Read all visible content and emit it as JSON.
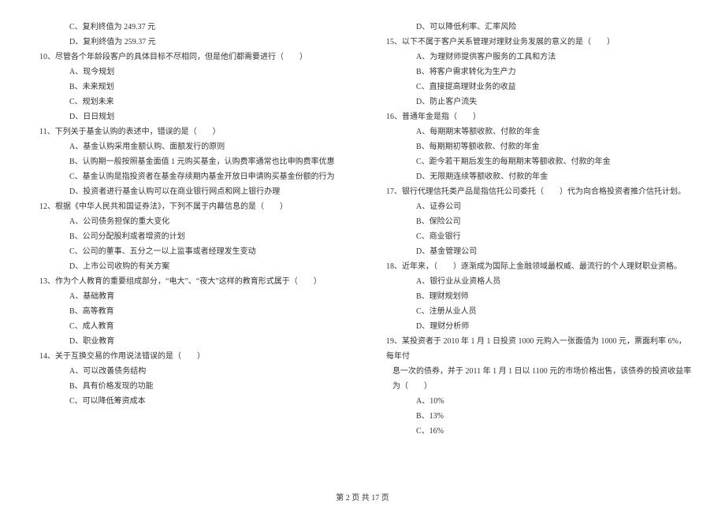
{
  "left": {
    "pre_opts": [
      "C、复利终值为 249.37 元",
      "D、复利终值为 259.37 元"
    ],
    "q10": {
      "stem": "10、尽管各个年龄段客户的具体目标不尽相同，但是他们都需要进行（　　）",
      "opts": [
        "A、现今规划",
        "B、未来规划",
        "C、规划未来",
        "D、日日规划"
      ]
    },
    "q11": {
      "stem": "11、下列关于基金认购的表述中，错误的是（　　）",
      "opts": [
        "A、基金认购采用金额认购、面额发行的原则",
        "B、认购期一般按照基金面值 1 元购买基金，认购费率通常也比申购费率优惠",
        "C、基金认购是指投资者在基金存续期内基金开放日申请购买基金份额的行为",
        "D、投资者进行基金认购可以在商业银行网点和网上银行办理"
      ]
    },
    "q12": {
      "stem": "12、根据《中华人民共和国证券法》，下列不属于内幕信息的是（　　）",
      "opts": [
        "A、公司债务担保的重大变化",
        "B、公司分配股利或者增资的计划",
        "C、公司的董事、五分之一以上监事或者经理发生变动",
        "D、上市公司收购的有关方案"
      ]
    },
    "q13": {
      "stem": "13、作为个人教育的重要组成部分，“电大”、“夜大”这样的教育形式属于（　　）",
      "opts": [
        "A、基础教育",
        "B、高等教育",
        "C、成人教育",
        "D、职业教育"
      ]
    },
    "q14": {
      "stem": "14、关于互换交易的作用说法错误的是（　　）",
      "opts": [
        "A、可以改善债务结构",
        "B、具有价格发现的功能",
        "C、可以降低筹资成本"
      ]
    }
  },
  "right": {
    "pre_opts": [
      "D、可以降低利率、汇率风险"
    ],
    "q15": {
      "stem": "15、以下不属于客户关系管理对理财业务发展的意义的是（　　）",
      "opts": [
        "A、为理财师提供客户服务的工具和方法",
        "B、将客户需求转化为生产力",
        "C、直接提高理财业务的收益",
        "D、防止客户流失"
      ]
    },
    "q16": {
      "stem": "16、普通年金是指（　　）",
      "opts": [
        "A、每期期末等额收款、付款的年金",
        "B、每期期初等额收款、付款的年金",
        "C、距今若干期后发生的每期期末等额收款、付款的年金",
        "D、无限期连续等额收款、付款的年金"
      ]
    },
    "q17": {
      "stem": "17、银行代理信托类产品是指信托公司委托（　　）代为向合格投资者推介信托计划。",
      "opts": [
        "A、证券公司",
        "B、保险公司",
        "C、商业银行",
        "D、基金管理公司"
      ]
    },
    "q18": {
      "stem": "18、近年来，（　　）逐渐成为国际上金融领域最权威、最流行的个人理财职业资格。",
      "opts": [
        "A、银行业从业资格人员",
        "B、理财规划师",
        "C、注册从业人员",
        "D、理财分析师"
      ]
    },
    "q19": {
      "line1": "19、某投资者于 2010 年 1 月 1 日投资 1000 元购入一张面值为 1000 元，票面利率 6%，每年付",
      "line2": "息一次的债券，并于 2011 年 1 月 1 日以 1100 元的市场价格出售，该债券的投资收益率为（　　）",
      "opts": [
        "A、10%",
        "B、13%",
        "C、16%"
      ]
    }
  },
  "footer": "第 2 页 共 17 页"
}
